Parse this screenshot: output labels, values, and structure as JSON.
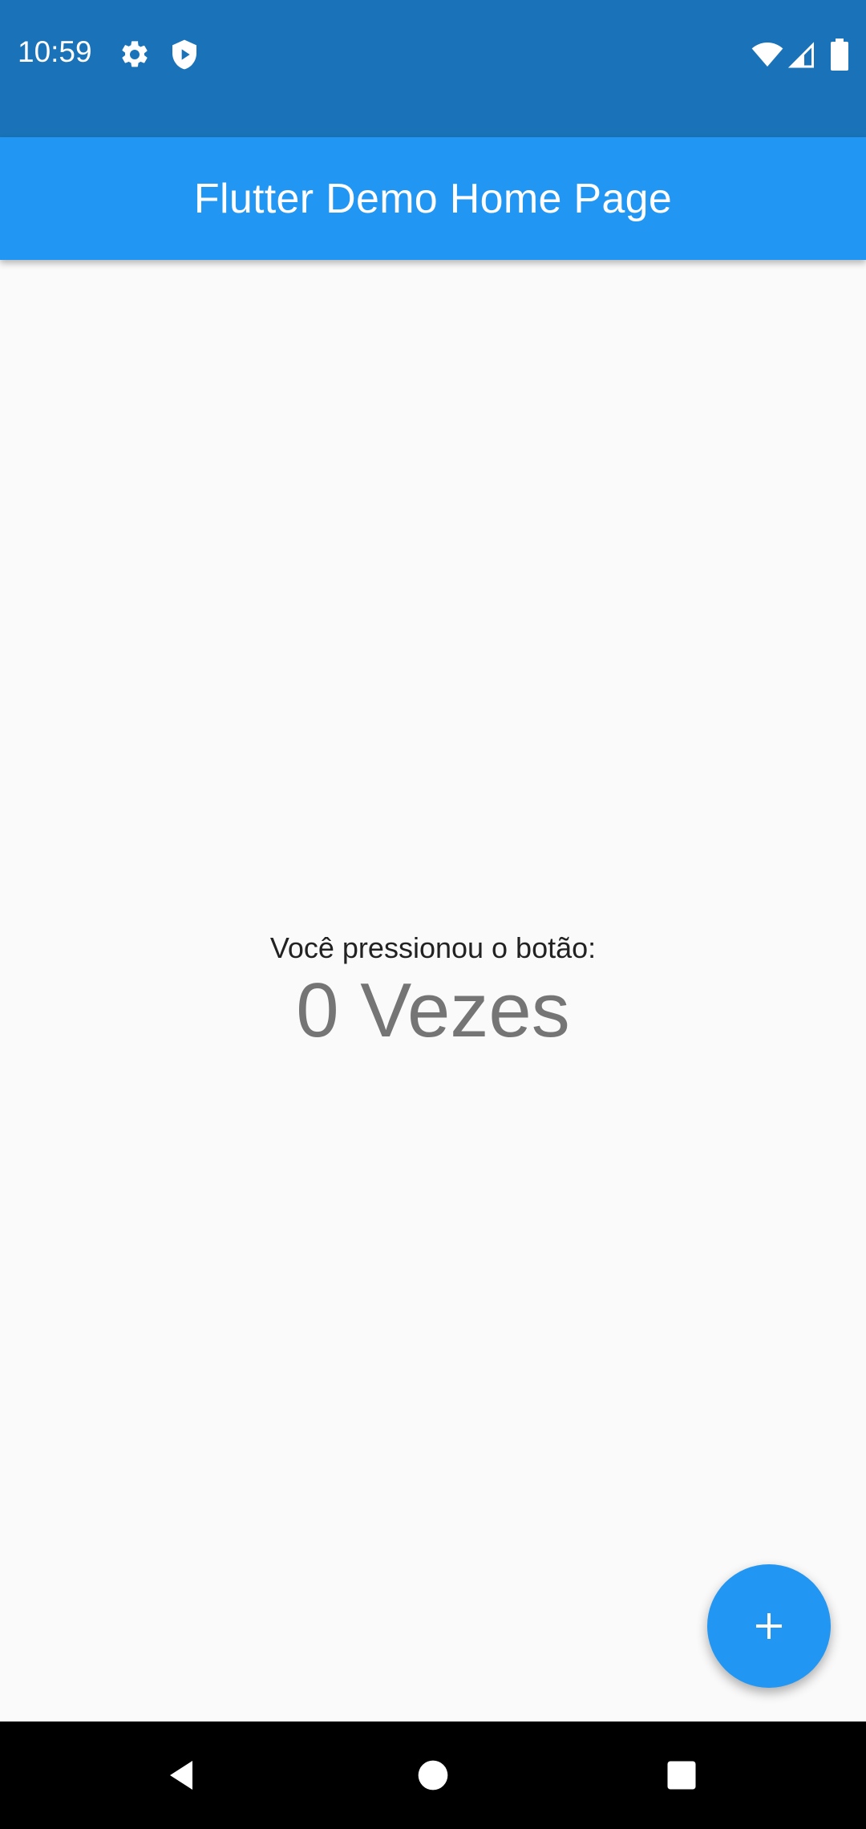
{
  "status_bar": {
    "time": "10:59",
    "left_icons": [
      "gear-icon",
      "shield-play-icon"
    ],
    "right_icons": [
      "wifi-icon",
      "cell-signal-icon",
      "battery-icon"
    ],
    "background": "#1a73b8"
  },
  "app_bar": {
    "title": "Flutter Demo Home Page",
    "background": "#2196f3"
  },
  "main": {
    "prompt": "Você pressionou o botão:",
    "counter": "0 Vezes"
  },
  "fab": {
    "icon": "plus-icon",
    "color": "#2196f3"
  },
  "nav_bar": {
    "buttons": [
      "back-icon",
      "home-icon",
      "recents-icon"
    ]
  }
}
